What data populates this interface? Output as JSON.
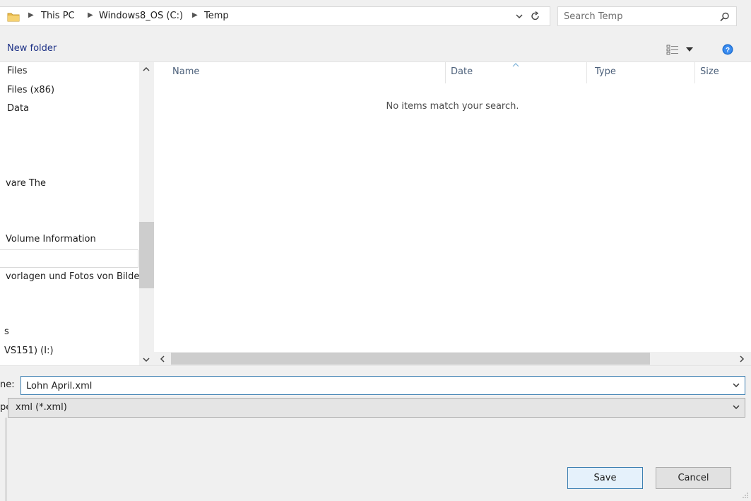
{
  "address": {
    "breadcrumbs": [
      "This PC",
      "Windows8_OS (C:)",
      "Temp"
    ]
  },
  "search": {
    "placeholder": "Search Temp"
  },
  "toolbar": {
    "new_folder_label": "New folder"
  },
  "nav": {
    "items": [
      "Files",
      "Files (x86)",
      "Data",
      "vare The",
      "Volume Information",
      "vorlagen und Fotos von Bilde",
      "s",
      "VS151) (I:)"
    ]
  },
  "file_list": {
    "columns": [
      "Name",
      "Date",
      "Type",
      "Size"
    ],
    "empty_message": "No items match your search."
  },
  "form": {
    "filename_label": "ne:",
    "filename_value": "Lohn April.xml",
    "filetype_label": "pe:",
    "filetype_value": "xml  (*.xml)"
  },
  "buttons": {
    "save": "Save",
    "cancel": "Cancel"
  },
  "colors": {
    "accent": "#3c7fb1",
    "link": "#1e3287",
    "chrome_bg": "#f0f0f0"
  }
}
